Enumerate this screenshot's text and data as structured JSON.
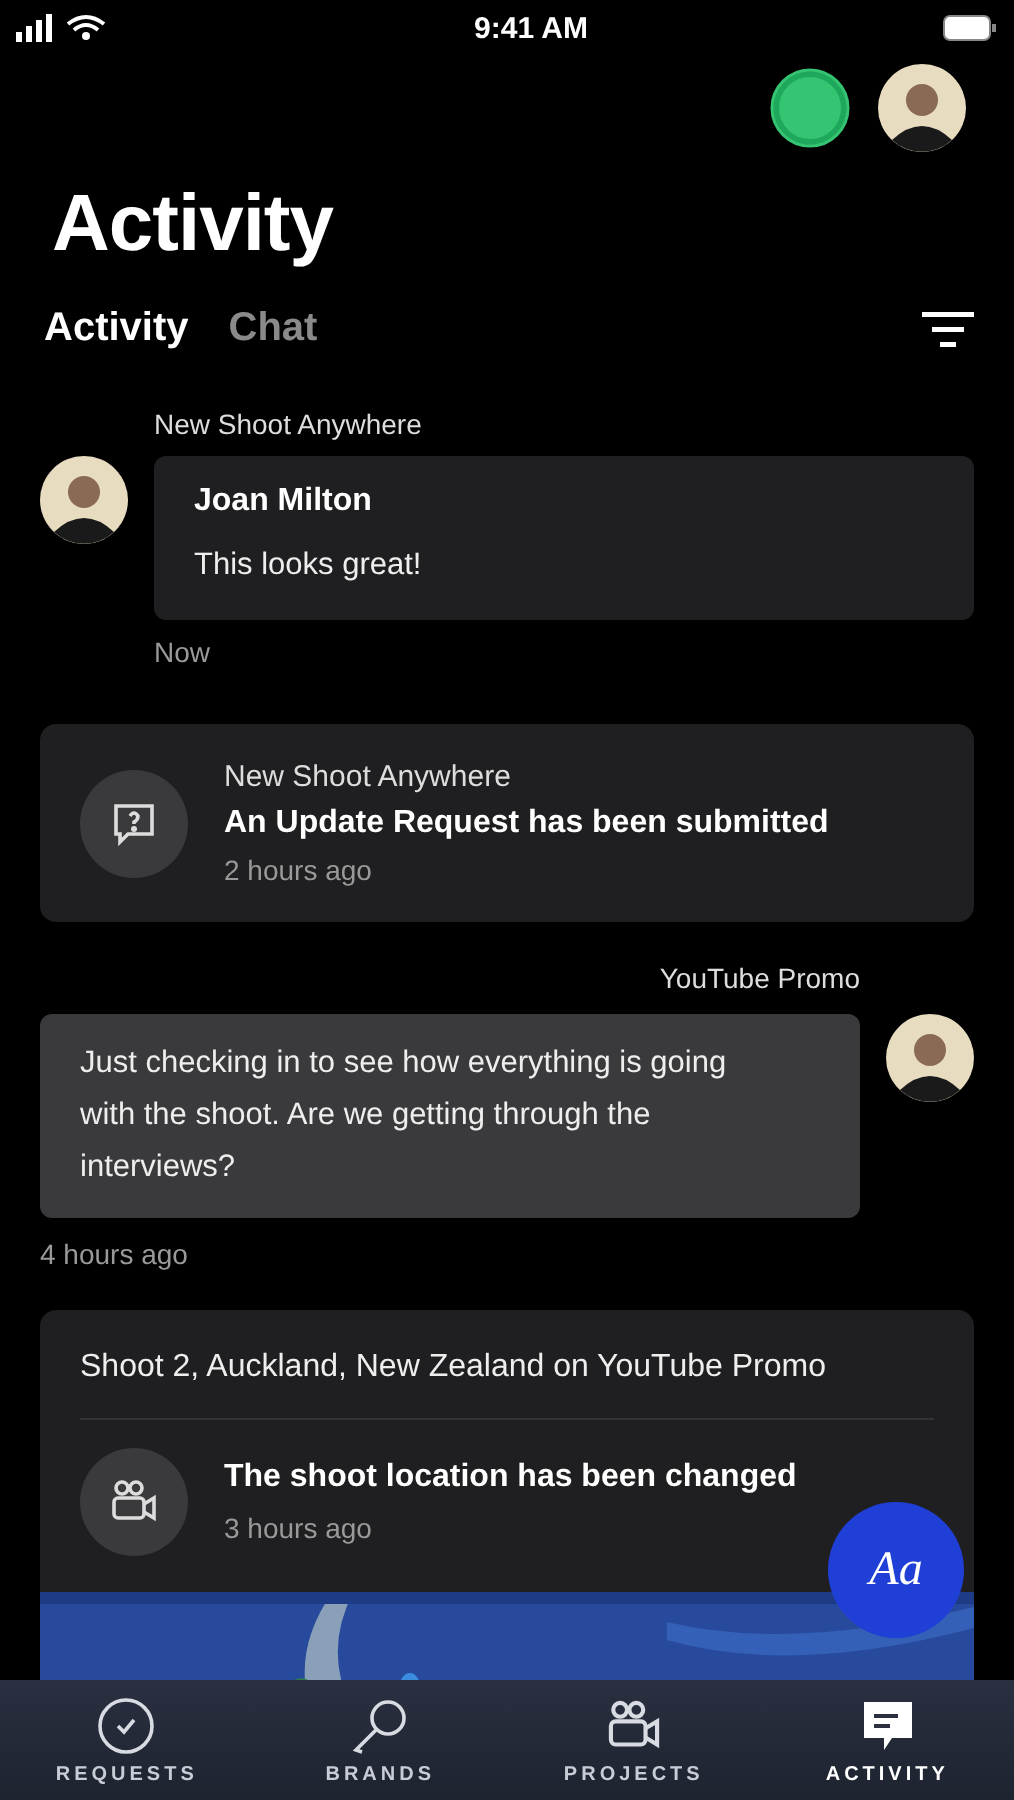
{
  "status_bar": {
    "time": "9:41 AM"
  },
  "header": {
    "title": "Activity",
    "online": true
  },
  "tabs": [
    {
      "label": "Activity",
      "selected": true
    },
    {
      "label": "Chat",
      "selected": false
    }
  ],
  "feed": [
    {
      "kind": "incoming",
      "project": "New Shoot Anywhere",
      "author": "Joan Milton",
      "message": "This looks great!",
      "time": "Now"
    },
    {
      "kind": "notice",
      "project": "New Shoot Anywhere",
      "title": "An Update Request has been submitted",
      "time": "2 hours ago"
    },
    {
      "kind": "outgoing",
      "project": "YouTube Promo",
      "message": "Just checking in to see how everything is going with the shoot. Are we getting through the interviews?",
      "time": "4 hours ago"
    },
    {
      "kind": "location",
      "heading": "Shoot 2, Auckland, New Zealand on YouTube Promo",
      "title": "The shoot location has been changed",
      "time": "3 hours ago"
    }
  ],
  "fab": {
    "label": "Aa"
  },
  "nav": [
    {
      "label": "REQUESTS",
      "selected": false
    },
    {
      "label": "BRANDS",
      "selected": false
    },
    {
      "label": "PROJECTS",
      "selected": false
    },
    {
      "label": "ACTIVITY",
      "selected": true
    }
  ]
}
